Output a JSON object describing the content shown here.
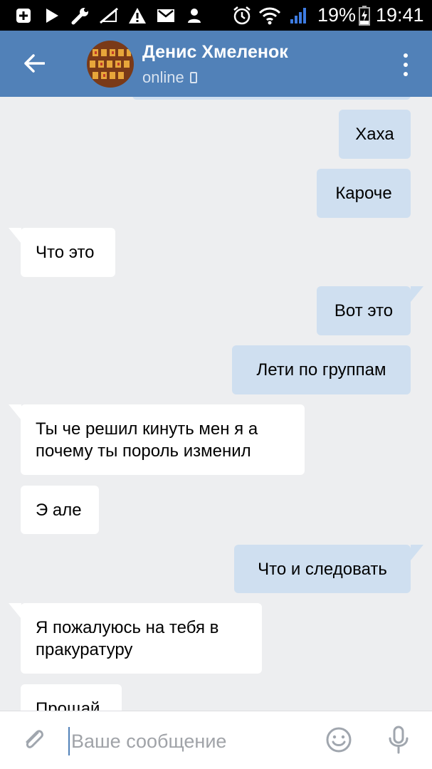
{
  "status_bar": {
    "battery_percent": "19%",
    "time": "19:41"
  },
  "header": {
    "contact_name": "Денис Хмеленок",
    "presence": "online"
  },
  "messages": [
    {
      "direction": "out",
      "text": "Хаха"
    },
    {
      "direction": "out",
      "text": "Кароче"
    },
    {
      "direction": "in",
      "text": "Что это"
    },
    {
      "direction": "out",
      "text": "Вот это"
    },
    {
      "direction": "out",
      "text": "Лети по группам"
    },
    {
      "direction": "in",
      "lines": [
        "Ты че решил кинуть мен я а",
        "почему ты пороль изменил"
      ]
    },
    {
      "direction": "in",
      "text": "Э але"
    },
    {
      "direction": "out",
      "text": "Что и следовать"
    },
    {
      "direction": "in",
      "lines": [
        "Я пожалуюсь на тебя в",
        "пракуратуру"
      ]
    },
    {
      "direction": "in",
      "text": "Прощай"
    }
  ],
  "composer": {
    "placeholder": "Ваше сообщение"
  },
  "colors": {
    "header": "#5181b8",
    "outgoing_bubble": "#cfdff0",
    "incoming_bubble": "#ffffff",
    "chat_background": "#edeef0"
  }
}
